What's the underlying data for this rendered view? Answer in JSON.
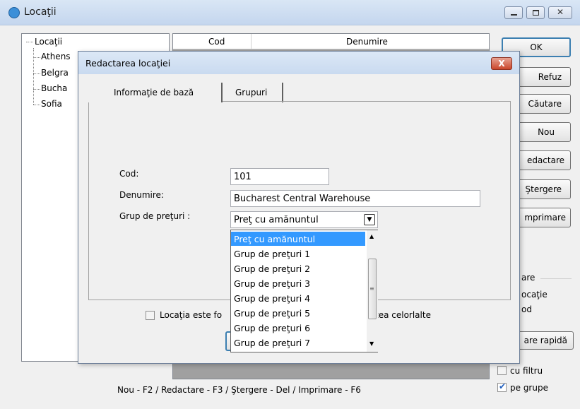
{
  "main_window": {
    "title": "Locaţii",
    "tree_items": [
      "Locaţii",
      "Athens",
      "Belgra",
      "Bucha",
      "Sofia"
    ],
    "grid_headers": [
      "Cod",
      "Denumire"
    ],
    "buttons": [
      "OK",
      "Refuz",
      "Căutare",
      "Nou",
      "edactare",
      "Ştergere",
      "mprimare"
    ],
    "side_labels": [
      "are",
      "ocaţie",
      "od"
    ],
    "quick_search_label": "are rapidă",
    "filter_checkbox_label": "cu filtru",
    "groups_checkbox_label": "pe grupe",
    "groups_checked": true,
    "shortcuts": "Nou - F2 / Redactare - F3 / Ştergere - Del / Imprimare - F6"
  },
  "dialog": {
    "title": "Redactarea locaţiei",
    "close_label": "X",
    "tabs": [
      "Informaţie de bază",
      "Grupuri"
    ],
    "labels": {
      "code": "Cod:",
      "name": "Denumire:",
      "price_group": "Grup de preţuri :"
    },
    "values": {
      "code": "101",
      "name": "Bucharest Central Warehouse",
      "price_group": "Preţ cu amănuntul"
    },
    "price_group_options": [
      "Preţ cu amănuntul",
      "Grup de preţuri 1",
      "Grup de preţuri 2",
      "Grup de preţuri 3",
      "Grup de preţuri 4",
      "Grup de preţuri 5",
      "Grup de preţuri 6",
      "Grup de preţuri 7"
    ],
    "checkbox_left_label": "Locaţia este fo",
    "checkbox_right_label": "tea celorlalte"
  }
}
